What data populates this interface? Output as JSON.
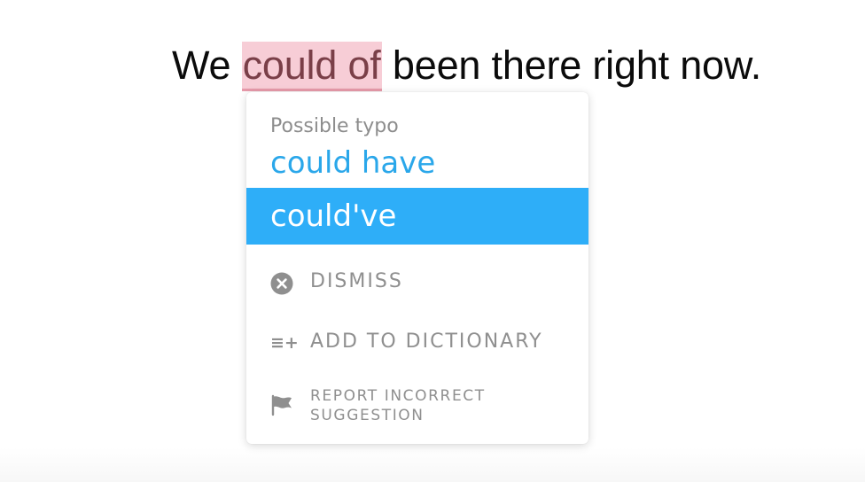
{
  "sentence": {
    "before": "We ",
    "flagged": "could of",
    "after": " been there right now."
  },
  "menu": {
    "label": "Possible typo",
    "suggestions": [
      "could have",
      "could've"
    ],
    "highlighted_suggestion": "could've",
    "actions": {
      "dismiss": {
        "label": "DISMISS",
        "icon": "close-circle-icon"
      },
      "add_to_dictionary": {
        "label": "ADD TO DICTIONARY",
        "icon": "add-list-icon"
      },
      "report": {
        "label": "REPORT INCORRECT SUGGESTION",
        "icon": "flag-icon"
      }
    },
    "add_icon_glyph": "≡+"
  },
  "colors": {
    "highlight_bg": "#f7cdd6",
    "suggestion_text": "#2aa7ea",
    "selected_bg": "#2eaef8",
    "muted": "#8f8f8f"
  }
}
